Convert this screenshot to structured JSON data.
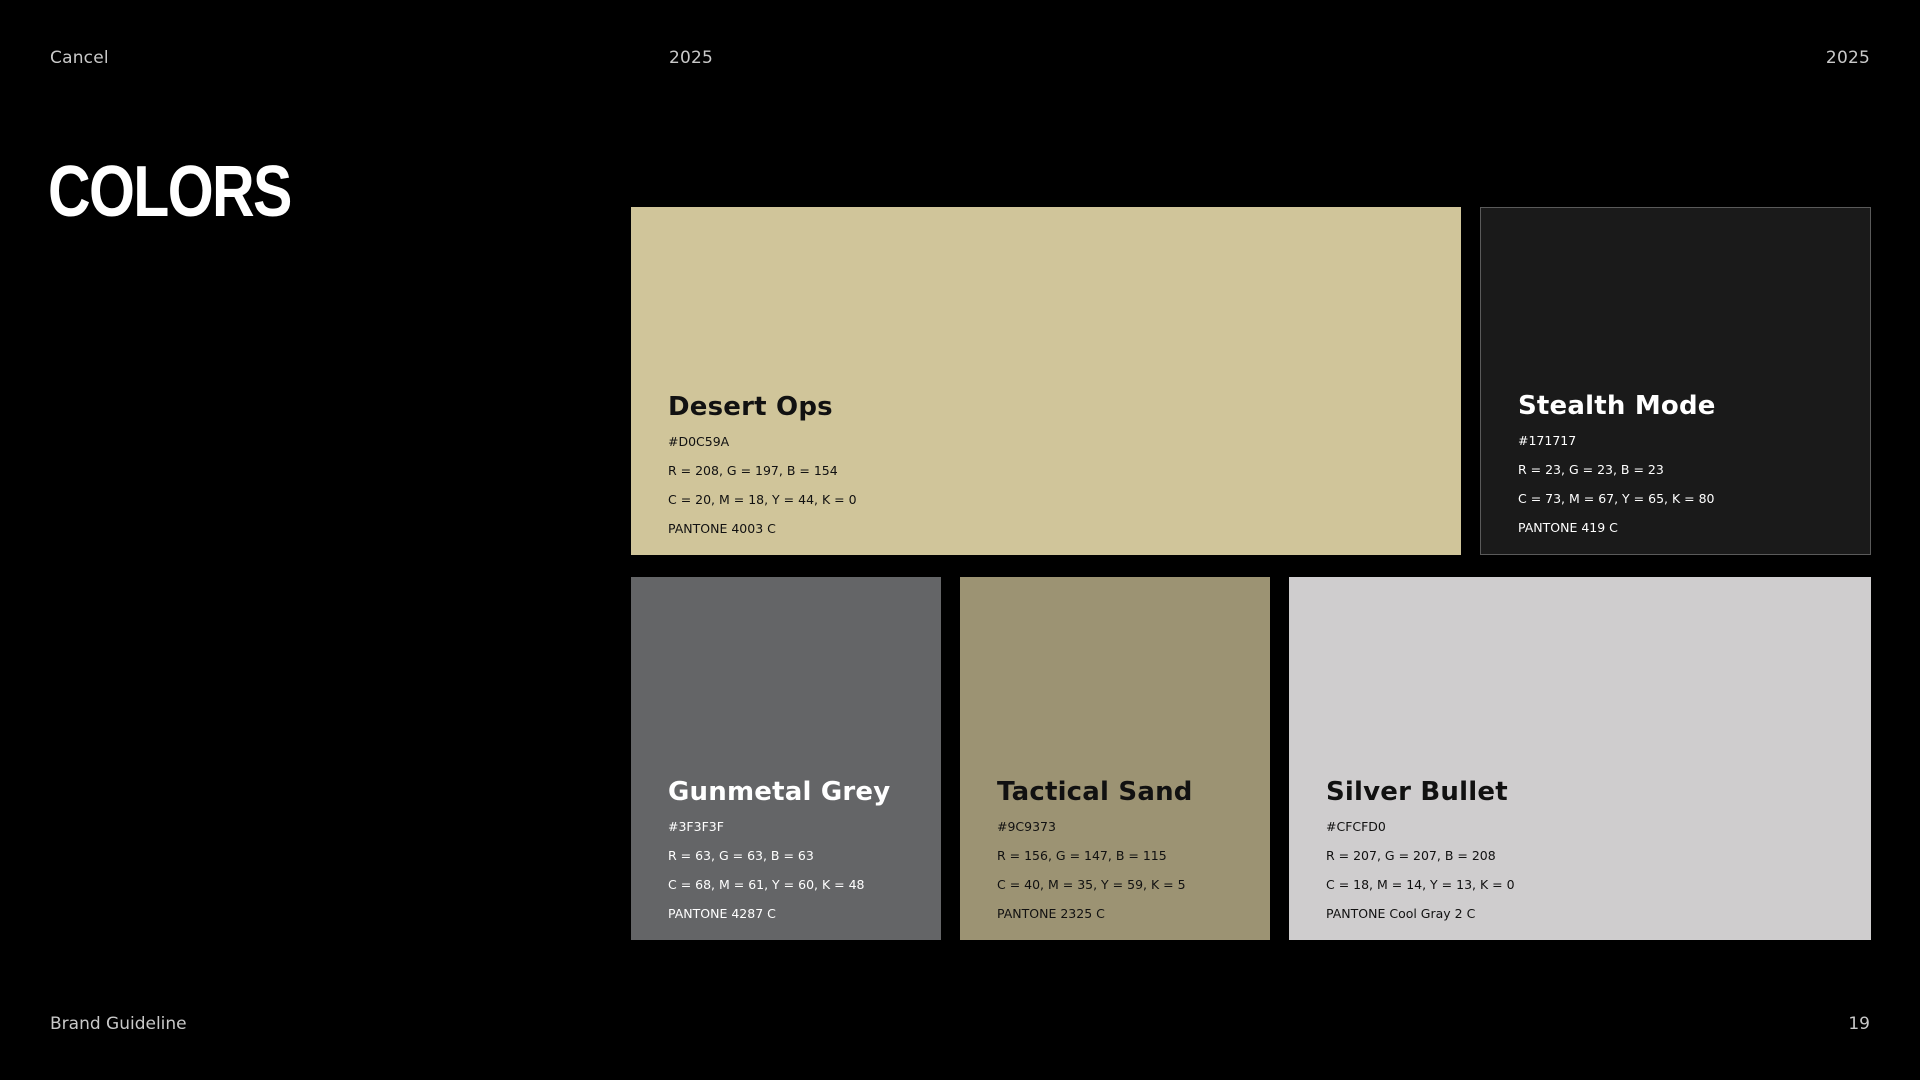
{
  "header": {
    "cancel_label": "Cancel",
    "year_center": "2025",
    "year_right": "2025"
  },
  "title": "COLORS",
  "swatches": [
    {
      "name": "Desert Ops",
      "hex": "#D0C59A",
      "rgb": "R = 208, G = 197, B = 154",
      "cmyk": "C = 20, M = 18, Y = 44, K = 0",
      "pantone": "PANTONE 4003 C",
      "bg_color": "#D0C59A",
      "text_color": "#111111"
    },
    {
      "name": "Stealth Mode",
      "hex": "#171717",
      "rgb": "R = 23, G = 23, B = 23",
      "cmyk": "C = 73, M = 67, Y = 65, K = 80",
      "pantone": "PANTONE 419 C",
      "bg_color": "#1A1A1A",
      "text_color": "#FFFFFF"
    },
    {
      "name": "Gunmetal Grey",
      "hex": "#3F3F3F",
      "rgb": "R = 63, G = 63, B = 63",
      "cmyk": "C = 68, M = 61, Y = 60, K = 48",
      "pantone": "PANTONE 4287 C",
      "bg_color": "#646567",
      "text_color": "#FFFFFF"
    },
    {
      "name": "Tactical Sand",
      "hex": "#9C9373",
      "rgb": "R = 156, G = 147, B = 115",
      "cmyk": "C = 40, M = 35, Y = 59, K = 5",
      "pantone": "PANTONE 2325 C",
      "bg_color": "#9C9373",
      "text_color": "#111111"
    },
    {
      "name": "Silver Bullet",
      "hex": "#CFCFD0",
      "rgb": "R = 207, G = 207, B = 208",
      "cmyk": "C = 18, M = 14, Y = 13, K = 0",
      "pantone": "PANTONE Cool Gray 2 C",
      "bg_color": "#CFCDCE",
      "text_color": "#111111"
    }
  ],
  "footer": {
    "left_label": "Brand Guideline",
    "page_number": "19"
  }
}
